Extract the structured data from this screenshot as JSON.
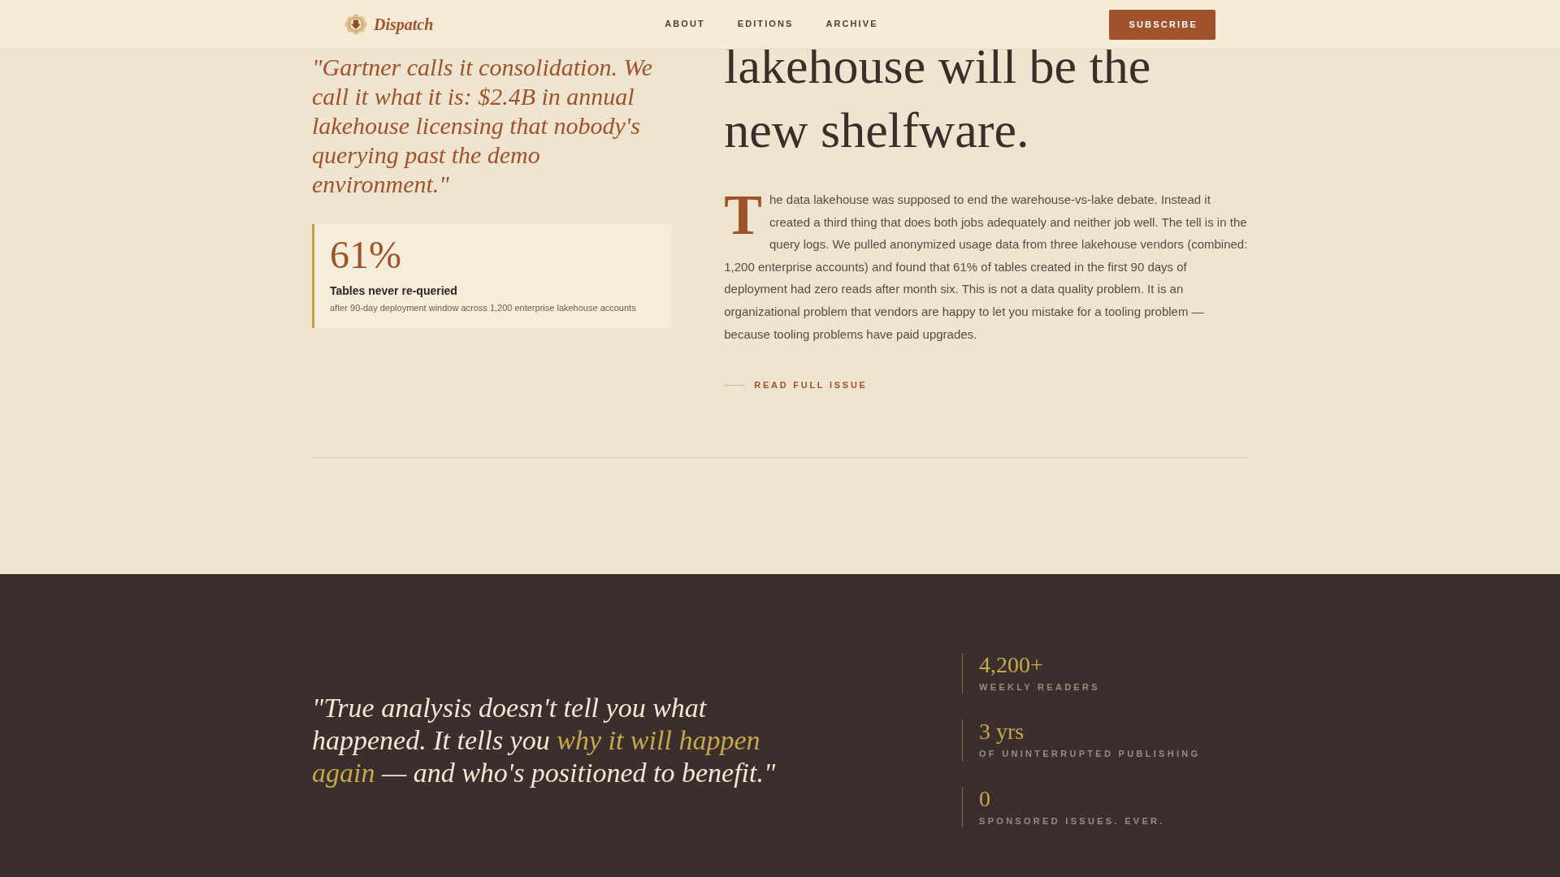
{
  "navbar": {
    "brand": "Dispatch",
    "links": [
      {
        "label": "ABOUT"
      },
      {
        "label": "EDITIONS"
      },
      {
        "label": "ARCHIVE"
      }
    ],
    "cta": "SUBSCRIBE"
  },
  "feature": {
    "pull_quote": "\"Gartner calls it consolidation. We call it what it is: $2.4B in annual lakehouse licensing that nobody's querying past the demo environment.\"",
    "stat": {
      "value": "61%",
      "label": "Tables never re-queried",
      "note": "after 90-day deployment window across 1,200 enterprise lakehouse accounts"
    },
    "headline": "lakehouse will be the new shelfware.",
    "body": "The data lakehouse was supposed to end the warehouse-vs-lake debate. Instead it created a third thing that does both jobs adequately and neither job well. The tell is in the query logs. We pulled anonymized usage data from three lakehouse vendors (combined: 1,200 enterprise accounts) and found that 61% of tables created in the first 90 days of deployment had zero reads after month six. This is not a data quality problem. It is an organizational problem that vendors are happy to let you mistake for a tooling problem — because tooling problems have paid upgrades.",
    "read_more": "READ FULL ISSUE"
  },
  "manifesto": {
    "quote_parts": [
      {
        "text": "\"True analysis doesn't tell you what happened. It tells you ",
        "highlight": false
      },
      {
        "text": "why it will happen again",
        "highlight": true
      },
      {
        "text": " — and who's positioned to benefit.\"",
        "highlight": false
      }
    ],
    "stats": [
      {
        "value": "4,200+",
        "label": "WEEKLY READERS"
      },
      {
        "value": "3 yrs",
        "label": "OF UNINTERRUPTED PUBLISHING"
      },
      {
        "value": "0",
        "label": "SPONSORED ISSUES. EVER."
      }
    ]
  }
}
